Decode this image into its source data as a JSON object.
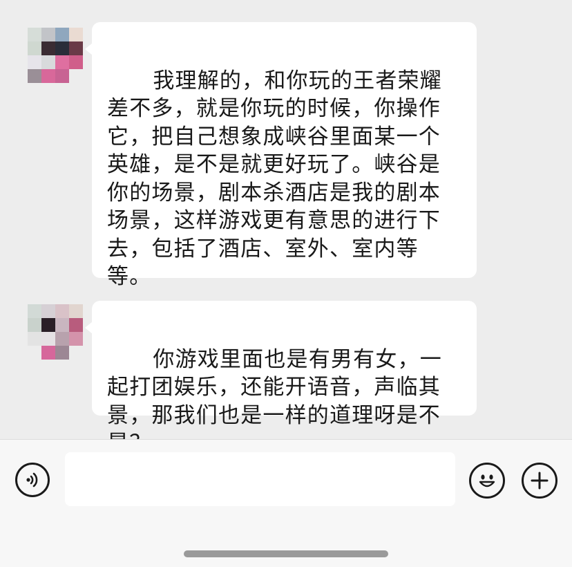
{
  "messages": [
    {
      "sender": "contact",
      "text": "我理解的，和你玩的王者荣耀差不多，就是你玩的时候，你操作它，把自己想象成峡谷里面某一个英雄，是不是就更好玩了。峡谷是你的场景，剧本杀酒店是我的剧本场景，这样游戏更有意思的进行下去，包括了酒店、室外、室内等等。"
    },
    {
      "sender": "contact",
      "text": "你游戏里面也是有男有女，一起打团娱乐，还能开语音，声临其景，那我们也是一样的道理呀是不是？"
    }
  ],
  "input_bar": {
    "value": "",
    "voice_icon": "voice-icon",
    "emoji_icon": "emoji-icon",
    "more_icon": "plus-icon"
  },
  "colors": {
    "chat_background": "#ededed",
    "bubble": "#ffffff",
    "input_bar_background": "#f7f7f7"
  }
}
